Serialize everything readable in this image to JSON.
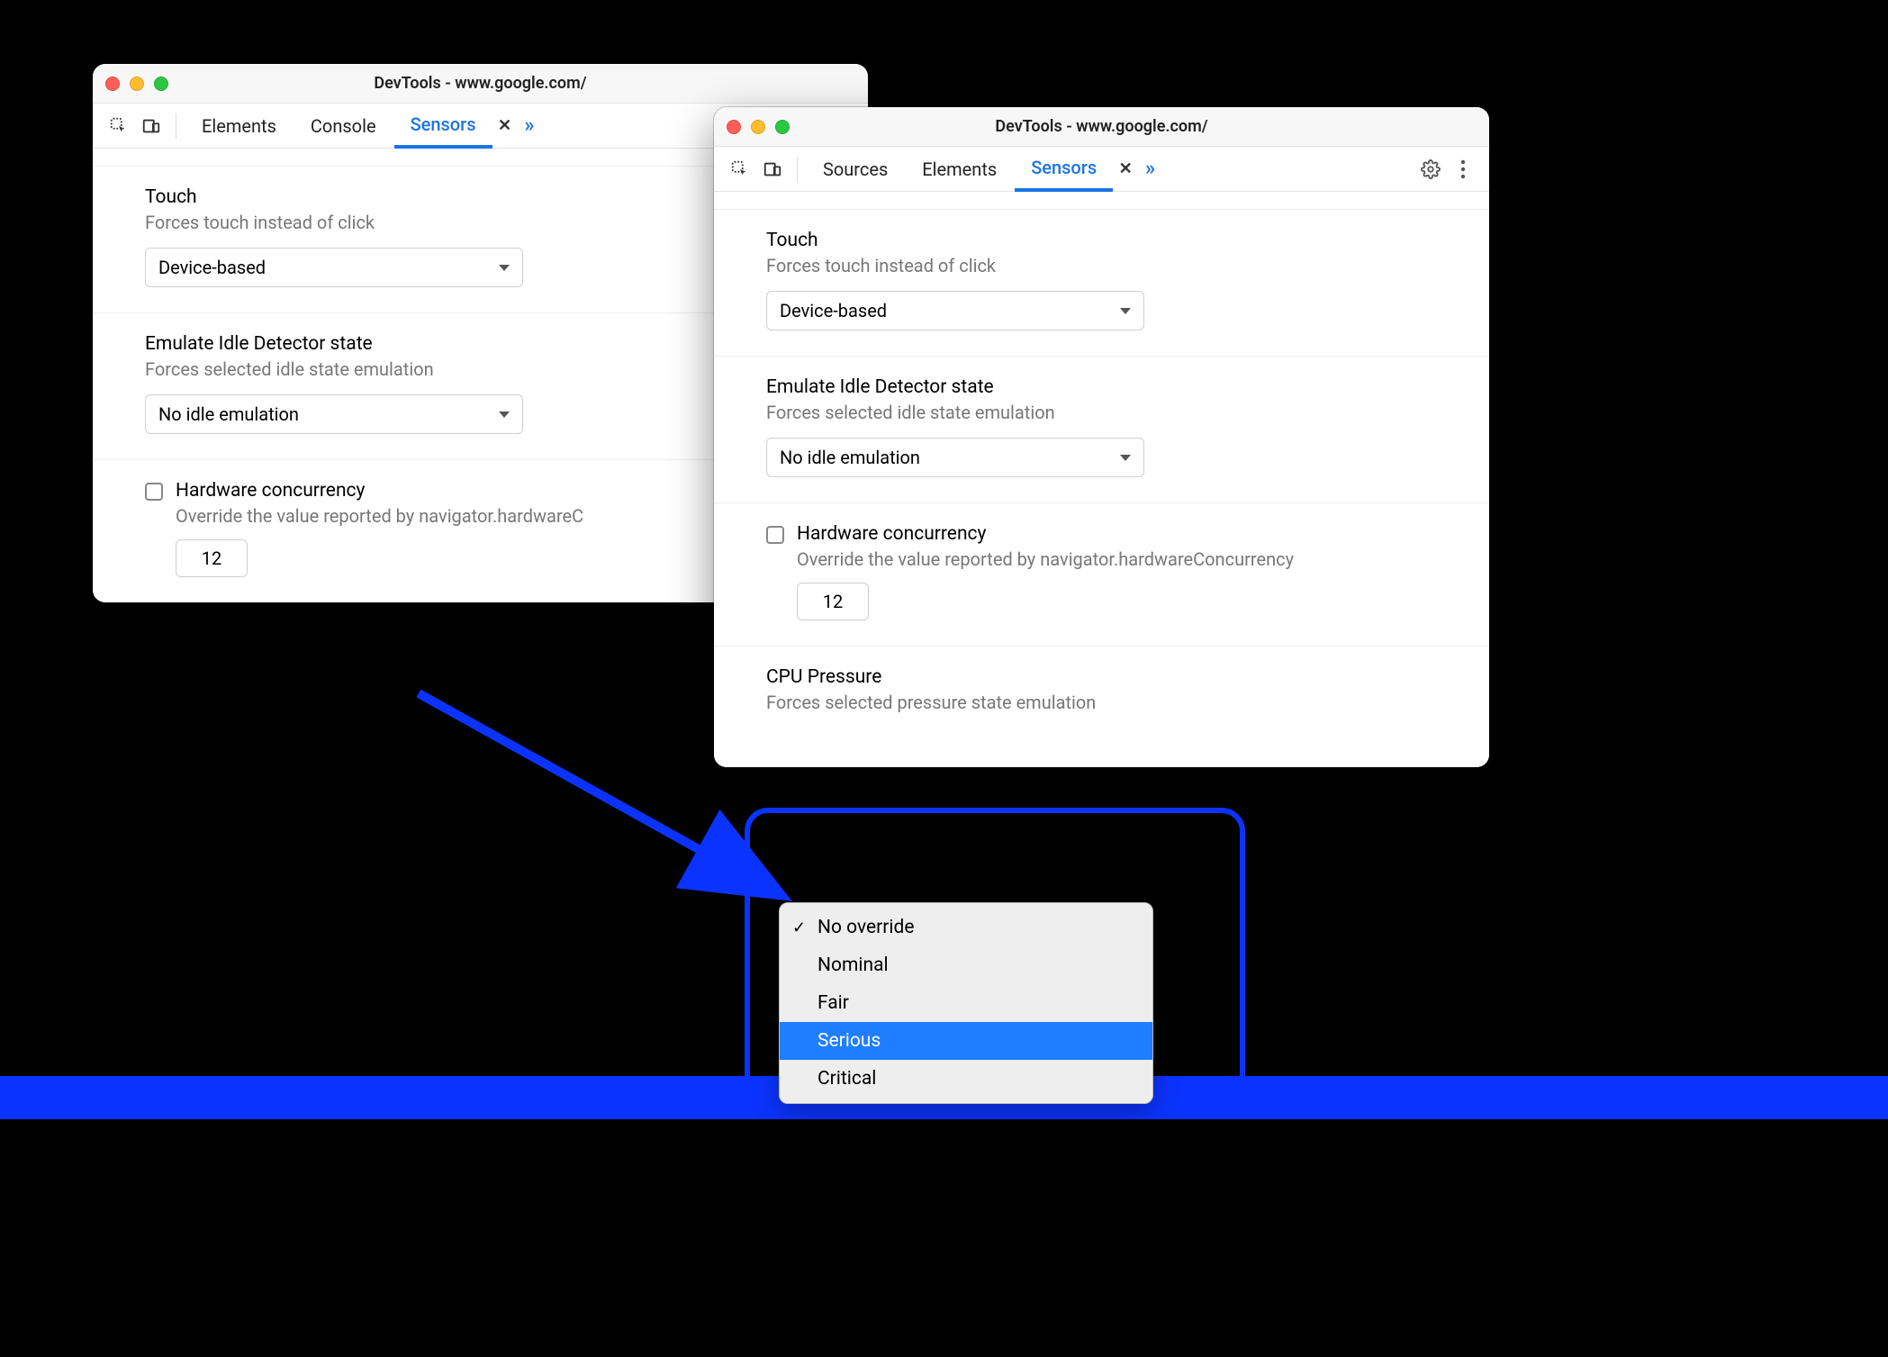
{
  "windows": {
    "left": {
      "title": "DevTools - www.google.com/",
      "tabs": [
        "Elements",
        "Console",
        "Sensors"
      ],
      "active_tab": "Sensors",
      "sections": {
        "touch": {
          "heading": "Touch",
          "sub": "Forces touch instead of click",
          "select_value": "Device-based"
        },
        "idle": {
          "heading": "Emulate Idle Detector state",
          "sub": "Forces selected idle state emulation",
          "select_value": "No idle emulation"
        },
        "hw": {
          "heading": "Hardware concurrency",
          "sub": "Override the value reported by navigator.hardwareC",
          "checked": false,
          "value": "12"
        }
      }
    },
    "right": {
      "title": "DevTools - www.google.com/",
      "tabs": [
        "Sources",
        "Elements",
        "Sensors"
      ],
      "active_tab": "Sensors",
      "sections": {
        "touch": {
          "heading": "Touch",
          "sub": "Forces touch instead of click",
          "select_value": "Device-based"
        },
        "idle": {
          "heading": "Emulate Idle Detector state",
          "sub": "Forces selected idle state emulation",
          "select_value": "No idle emulation"
        },
        "hw": {
          "heading": "Hardware concurrency",
          "sub": "Override the value reported by navigator.hardwareConcurrency",
          "checked": false,
          "value": "12"
        },
        "cpu": {
          "heading": "CPU Pressure",
          "sub": "Forces selected pressure state emulation"
        }
      },
      "cpu_dropdown": {
        "options": [
          "No override",
          "Nominal",
          "Fair",
          "Serious",
          "Critical"
        ],
        "checked": "No override",
        "highlighted": "Serious"
      }
    }
  }
}
